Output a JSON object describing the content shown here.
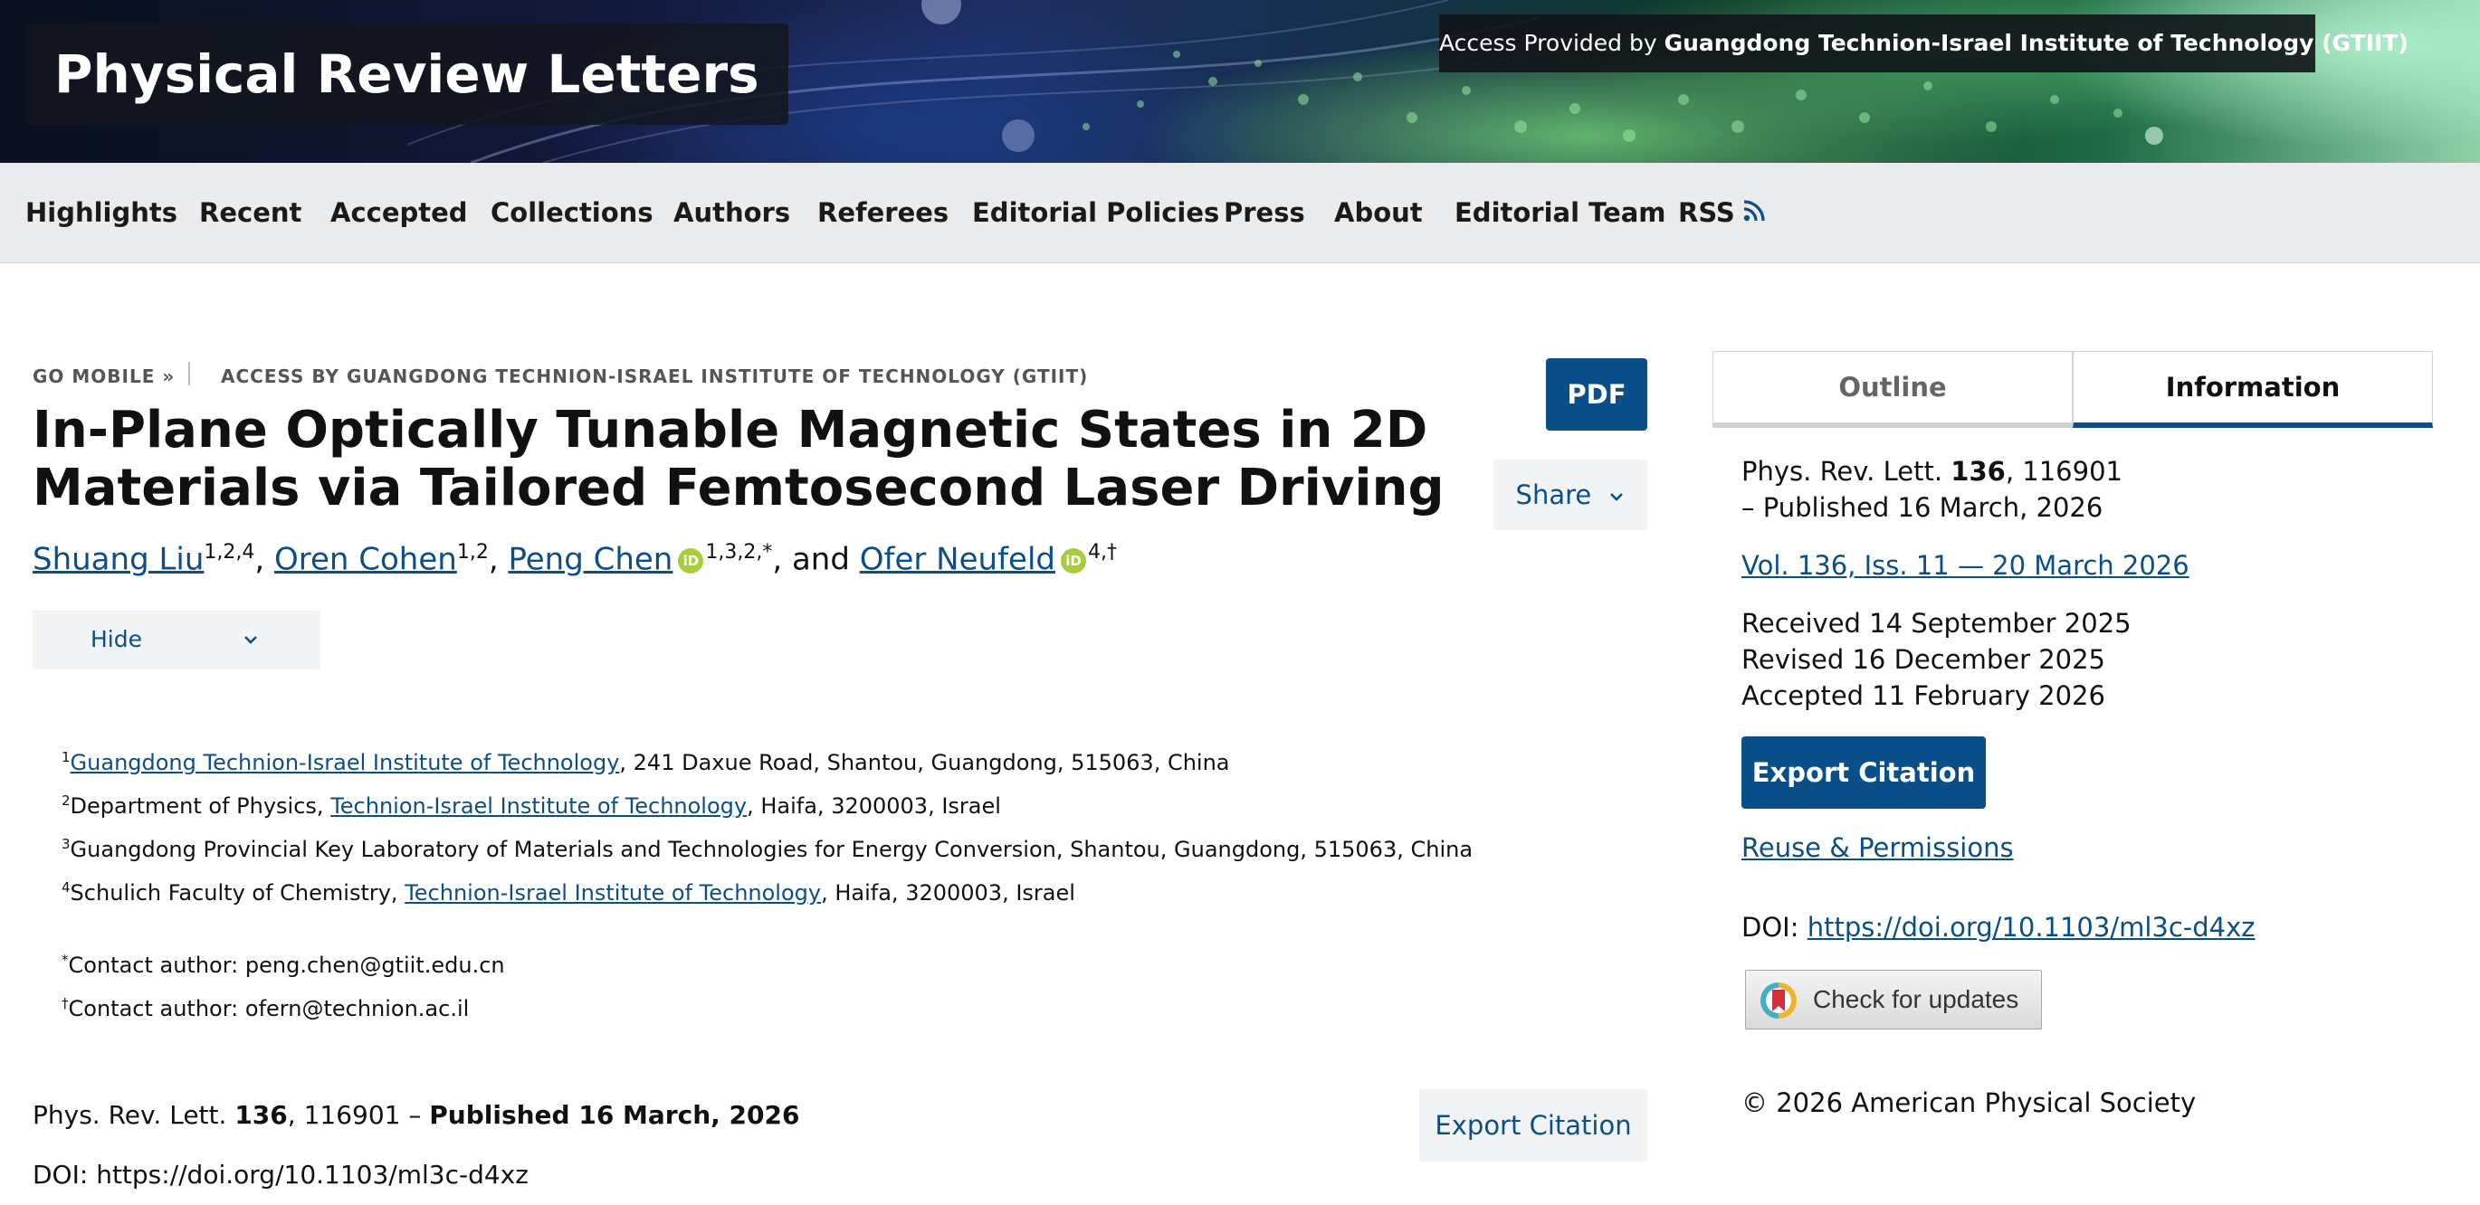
{
  "header": {
    "journal_title": "Physical Review Letters",
    "access_prefix": "Access Provided by ",
    "access_institution": "Guangdong Technion-Israel Institute of Technology (GTIIT)"
  },
  "nav": {
    "items": [
      "Highlights",
      "Recent",
      "Accepted",
      "Collections",
      "Authors",
      "Referees",
      "Editorial Policies",
      "Press",
      "About",
      "Editorial Team",
      "RSS"
    ]
  },
  "breadcrumb": {
    "mobile": "GO MOBILE »",
    "access": "ACCESS BY GUANGDONG TECHNION-ISRAEL INSTITUTE OF TECHNOLOGY (GTIIT)"
  },
  "article": {
    "title_line1": "In-Plane Optically Tunable Magnetic States in 2D",
    "title_line2": "Materials via Tailored Femtosecond Laser Driving",
    "pdf_label": "PDF",
    "share_label": "Share",
    "hide_label": "Hide",
    "authors": [
      {
        "name": "Shuang Liu",
        "sup": "1,2,4"
      },
      {
        "name": "Oren Cohen",
        "sup": "1,2"
      },
      {
        "name": "Peng Chen",
        "sup": "1,3,2,*"
      },
      {
        "name": "Ofer Neufeld",
        "sup": "4,†"
      }
    ],
    "and_text": ", and ",
    "orcid_text": "iD",
    "affiliations": {
      "a1": {
        "sup": "1",
        "link": "Guangdong Technion-Israel Institute of Technology",
        "rest": ", 241 Daxue Road, Shantou, Guangdong, 515063, China"
      },
      "a2": {
        "sup": "2",
        "pre": "Department of Physics, ",
        "link": "Technion-Israel Institute of Technology",
        "rest": ", Haifa, 3200003, Israel"
      },
      "a3": {
        "sup": "3",
        "text": "Guangdong Provincial Key Laboratory of Materials and Technologies for Energy Conversion, Shantou, Guangdong, 515063, China"
      },
      "a4": {
        "sup": "4",
        "pre": "Schulich Faculty of Chemistry, ",
        "link": "Technion-Israel Institute of Technology",
        "rest": ", Haifa, 3200003, Israel"
      }
    },
    "contacts": {
      "c1": {
        "sup": "*",
        "text": "Contact author: peng.chen@gtiit.edu.cn"
      },
      "c2": {
        "sup": "†",
        "text": "Contact author: ofern@technion.ac.il"
      }
    },
    "citation": {
      "journal": "Phys. Rev. Lett. ",
      "volume": "136",
      "article_no": ", 116901 – ",
      "published": "Published 16 March, 2026"
    },
    "doi_text": "DOI: https://doi.org/10.1103/ml3c-d4xz",
    "export_label": "Export Citation"
  },
  "sidebar": {
    "tabs": [
      "Outline",
      "Information"
    ],
    "journal": "Phys. Rev. Lett. ",
    "volume": "136",
    "article_no": ", 116901",
    "published": "– Published 16 March, 2026",
    "issue_link": "Vol. 136, Iss. 11 — 20 March 2026",
    "received": "Received 14 September 2025",
    "revised": "Revised 16 December 2025",
    "accepted": "Accepted 11 February 2026",
    "export_label": "Export Citation",
    "reuse_label": "Reuse & Permissions",
    "doi_prefix": "DOI: ",
    "doi_link": "https://doi.org/10.1103/ml3c-d4xz",
    "updates_label": "Check for updates",
    "copyright": "© 2026 American Physical Society"
  },
  "colors": {
    "accent": "#0b4f8a",
    "orcid": "#a6ce39"
  }
}
